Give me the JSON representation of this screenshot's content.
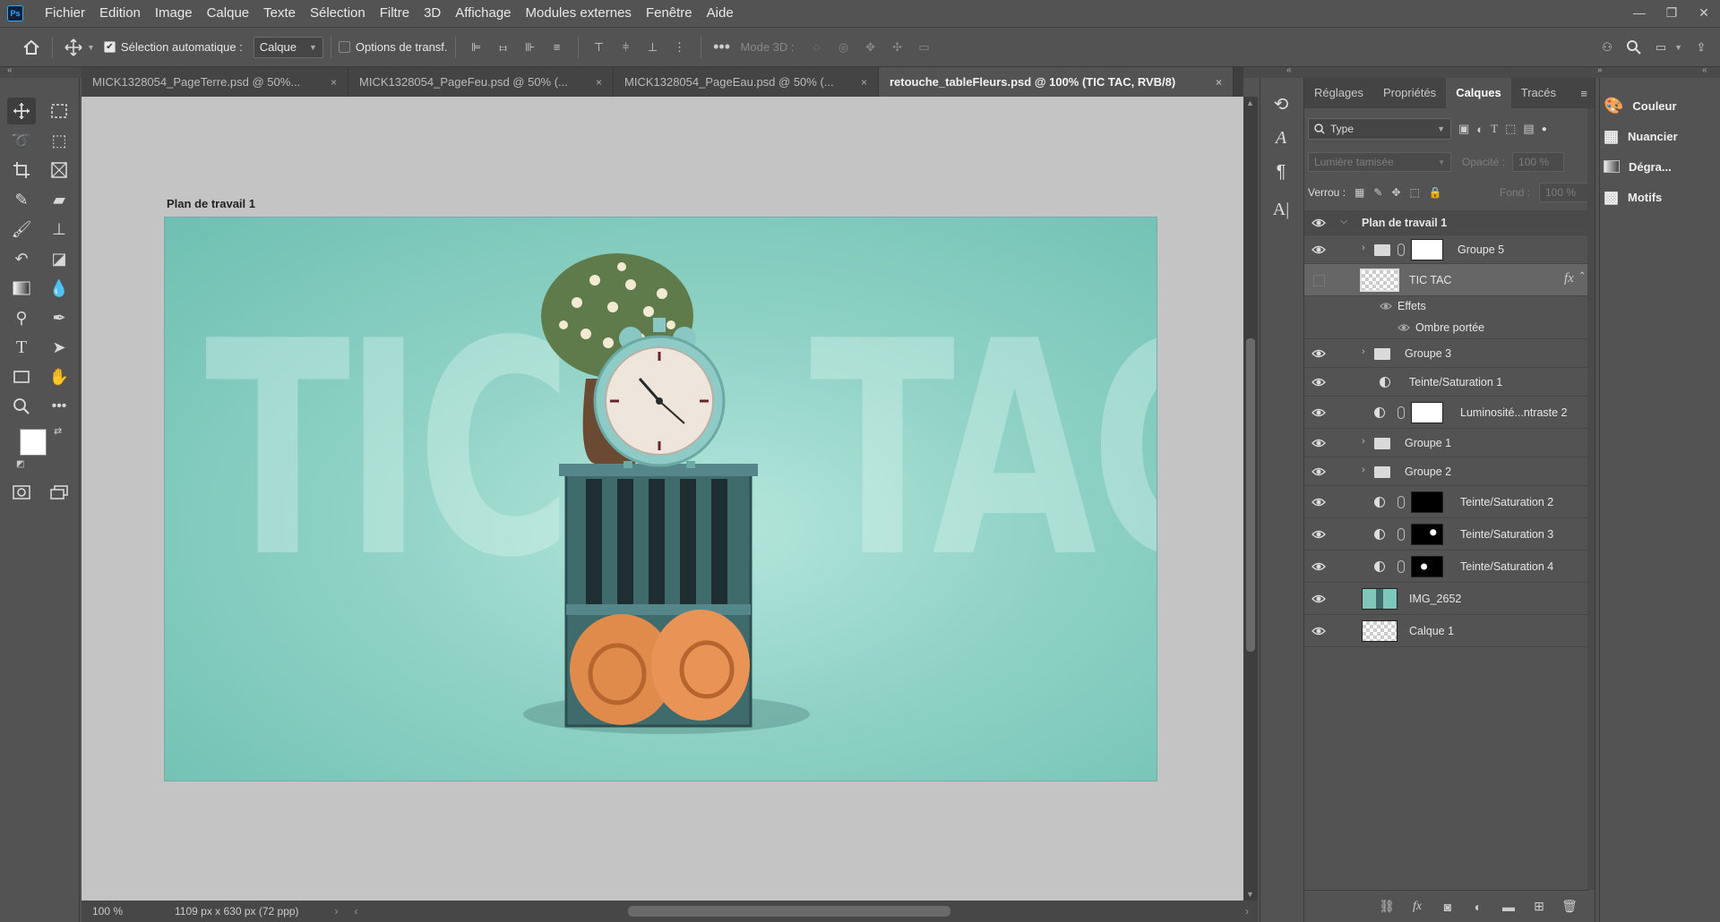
{
  "menu": [
    "Fichier",
    "Edition",
    "Image",
    "Calque",
    "Texte",
    "Sélection",
    "Filtre",
    "3D",
    "Affichage",
    "Modules externes",
    "Fenêtre",
    "Aide"
  ],
  "app_logo": "Ps",
  "options": {
    "auto_select_label": "Sélection automatique :",
    "auto_select_value": "Calque",
    "transform_label": "Options de transf.",
    "mode3d_label": "Mode 3D :"
  },
  "tabs": [
    {
      "label": "MICK1328054_PageTerre.psd @ 50%...",
      "close": "×"
    },
    {
      "label": "MICK1328054_PageFeu.psd @ 50% (...",
      "close": "×"
    },
    {
      "label": "MICK1328054_PageEau.psd @ 50% (...",
      "close": "×"
    },
    {
      "label": "retouche_tableFleurs.psd @ 100% (TIC TAC, RVB/8)",
      "close": "×"
    }
  ],
  "artboard_label": "Plan de travail 1",
  "artwork": {
    "text_left": "TIC",
    "text_right": "TAC"
  },
  "status": {
    "zoom": "100 %",
    "doc_size": "1109 px x 630 px (72 ppp)"
  },
  "panel_tabs": [
    "Réglages",
    "Propriétés",
    "Calques",
    "Tracés"
  ],
  "layers_panel": {
    "filter_value": "Type",
    "blend_mode": "Lumière tamisée",
    "opacity_label": "Opacité :",
    "opacity_value": "100 %",
    "lock_label": "Verrou :",
    "fill_label": "Fond :",
    "fill_value": "100 %",
    "fx_label": "fx"
  },
  "layers": {
    "artboard": "Plan de travail 1",
    "groupe5": "Groupe 5",
    "tictac": "TIC TAC",
    "effets": "Effets",
    "ombre": "Ombre portée",
    "groupe3": "Groupe 3",
    "teinte1": "Teinte/Saturation 1",
    "lumi2": "Luminosité...ntraste 2",
    "groupe1": "Groupe 1",
    "groupe2": "Groupe 2",
    "teinte2": "Teinte/Saturation 2",
    "teinte3": "Teinte/Saturation 3",
    "teinte4": "Teinte/Saturation 4",
    "img": "IMG_2652",
    "calque1": "Calque 1"
  },
  "side_panels": [
    "Couleur",
    "Nuancier",
    "Dégra...",
    "Motifs"
  ],
  "colors": {
    "foreground": "#ffffff",
    "background": "#000000",
    "accent": "#31a8ff"
  }
}
